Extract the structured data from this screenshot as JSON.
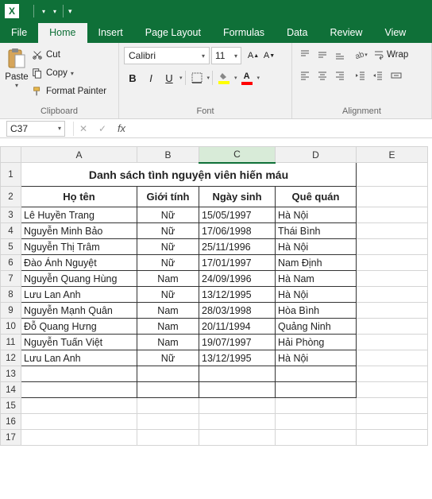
{
  "qat": {
    "excel": "X"
  },
  "tabs": {
    "file": "File",
    "home": "Home",
    "insert": "Insert",
    "page_layout": "Page Layout",
    "formulas": "Formulas",
    "data": "Data",
    "review": "Review",
    "view": "View"
  },
  "clipboard": {
    "paste": "Paste",
    "cut": "Cut",
    "copy": "Copy",
    "format_painter": "Format Painter",
    "label": "Clipboard"
  },
  "font": {
    "name": "Calibri",
    "size": "11",
    "label": "Font",
    "bold": "B",
    "italic": "I",
    "underline": "U"
  },
  "alignment": {
    "label": "Alignment",
    "wrap": "Wrap"
  },
  "name_box": "C37",
  "columns": {
    "a": "A",
    "b": "B",
    "c": "C",
    "d": "D",
    "e": "E"
  },
  "sheet": {
    "title": "Danh sách tình nguyện viên hiến máu",
    "headers": {
      "name": "Họ tên",
      "gender": "Giới tính",
      "dob": "Ngày sinh",
      "hometown": "Quê quán"
    },
    "rows": [
      {
        "name": "Lê Huyền Trang",
        "gender": "Nữ",
        "dob": "15/05/1997",
        "hometown": "Hà Nội"
      },
      {
        "name": "Nguyễn Minh Bảo",
        "gender": "Nữ",
        "dob": "17/06/1998",
        "hometown": "Thái Bình"
      },
      {
        "name": "Nguyễn Thị Trâm",
        "gender": "Nữ",
        "dob": "25/11/1996",
        "hometown": "Hà Nội"
      },
      {
        "name": "Đào Ánh Nguyệt",
        "gender": "Nữ",
        "dob": "17/01/1997",
        "hometown": "Nam Định"
      },
      {
        "name": "Nguyễn Quang Hùng",
        "gender": "Nam",
        "dob": "24/09/1996",
        "hometown": "Hà Nam"
      },
      {
        "name": "Lưu Lan Anh",
        "gender": "Nữ",
        "dob": "13/12/1995",
        "hometown": "Hà Nội"
      },
      {
        "name": "Nguyễn Mạnh Quân",
        "gender": "Nam",
        "dob": "28/03/1998",
        "hometown": "Hòa Bình"
      },
      {
        "name": "Đỗ Quang Hưng",
        "gender": "Nam",
        "dob": "20/11/1994",
        "hometown": "Quảng Ninh"
      },
      {
        "name": "Nguyễn Tuấn Việt",
        "gender": "Nam",
        "dob": "19/07/1997",
        "hometown": "Hải Phòng"
      },
      {
        "name": "Lưu Lan Anh",
        "gender": "Nữ",
        "dob": "13/12/1995",
        "hometown": "Hà Nội"
      }
    ]
  },
  "rownums": [
    "1",
    "2",
    "3",
    "4",
    "5",
    "6",
    "7",
    "8",
    "9",
    "10",
    "11",
    "12",
    "13",
    "14",
    "15",
    "16",
    "17"
  ]
}
